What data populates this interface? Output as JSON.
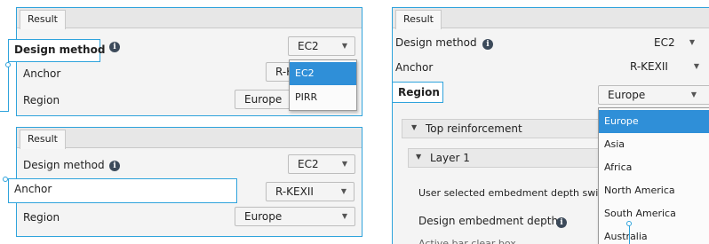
{
  "panel_a": {
    "tab": "Result",
    "rows": {
      "design_method": "Design method",
      "anchor": "Anchor",
      "region": "Region"
    },
    "design_method_value": "EC2",
    "anchor_value": "R-K",
    "region_value": "Europe",
    "dropdown": [
      "EC2",
      "PIRR"
    ]
  },
  "panel_b": {
    "tab": "Result",
    "rows": {
      "design_method": "Design method",
      "anchor": "Anchor",
      "region": "Region"
    },
    "design_method_value": "EC2",
    "anchor_value": "R-KEXII",
    "region_value": "Europe"
  },
  "panel_c": {
    "tab": "Result",
    "rows": {
      "design_method": "Design method",
      "anchor": "Anchor",
      "region": "Region"
    },
    "design_method_value": "EC2",
    "anchor_value": "R-KEXII",
    "region_value": "Europe",
    "top_reinforcement": "Top reinforcement",
    "layer": "Layer 1",
    "user_selected": "User selected embedment depth swit",
    "design_embedment": "Design embedment depth",
    "cutoff": "Active bar clear box",
    "dropdown": [
      "Europe",
      "Asia",
      "Africa",
      "North America",
      "South America",
      "Australia"
    ]
  },
  "colors": {
    "accent": "#2fa3dc",
    "selected": "#2f8fd8"
  },
  "icons": {
    "info": "info-icon",
    "caret": "caret-down-icon",
    "triangle": "triangle-down-icon"
  }
}
